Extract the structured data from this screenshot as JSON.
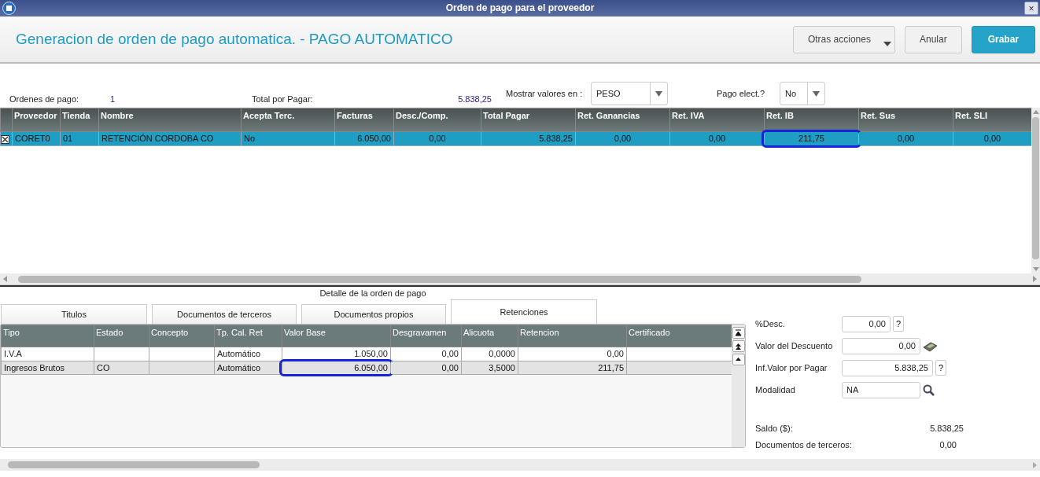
{
  "window": {
    "title": "Orden de pago para el proveedor",
    "close": "×"
  },
  "header": {
    "title": "Generacion de orden de pago automatica. - PAGO AUTOMATICO",
    "buttons": [
      {
        "label": "Otras acciones",
        "kind": "dropdown"
      },
      {
        "label": "Anular",
        "kind": "default"
      },
      {
        "label": "Grabar",
        "kind": "primary"
      }
    ]
  },
  "summary": [
    {
      "kind": "value",
      "label": "Ordenes de pago:",
      "value": "1"
    },
    {
      "kind": "value",
      "label": "Total por Pagar:",
      "value": "5.838,25"
    },
    {
      "kind": "select",
      "label": "Mostrar valores en :",
      "value": "PESO"
    },
    {
      "kind": "select",
      "label": "Pago elect.?",
      "value": "No"
    }
  ],
  "orders_table": {
    "columns": [
      "Proveedor",
      "Tienda",
      "Nombre",
      "Acepta Terc.",
      "Facturas",
      "Desc./Comp.",
      "Total Pagar",
      "Ret. Ganancias",
      "Ret. IVA",
      "Ret. IB",
      "Ret. Sus",
      "Ret. SLI"
    ],
    "rows": [
      {
        "checked": true,
        "selected": true,
        "cells": [
          {
            "text": "CORET0",
            "highlighted": false
          },
          {
            "text": "01",
            "highlighted": false
          },
          {
            "text": "RETENCIÓN CORDOBA CO",
            "highlighted": false
          },
          {
            "text": "No",
            "highlighted": false
          },
          {
            "text": "6.050,00",
            "highlighted": false
          },
          {
            "text": "0,00",
            "highlighted": false
          },
          {
            "text": "5.838,25",
            "highlighted": false
          },
          {
            "text": "0,00",
            "highlighted": false
          },
          {
            "text": "0,00",
            "highlighted": false
          },
          {
            "text": "211,75",
            "highlighted": true
          },
          {
            "text": "0,00",
            "highlighted": false
          },
          {
            "text": "0,00",
            "highlighted": false
          }
        ]
      }
    ]
  },
  "detail": {
    "caption": "Detalle de la orden de pago",
    "tabs": [
      {
        "label": "Titulos",
        "selected": false
      },
      {
        "label": "Documentos de terceros",
        "selected": false
      },
      {
        "label": "Documentos propios",
        "selected": false
      },
      {
        "label": "Retenciones",
        "selected": true
      }
    ],
    "table": {
      "columns": [
        "Tipo",
        "Estado",
        "Concepto",
        "Tp. Cal. Ret",
        "Valor Base",
        "Desgravamen",
        "Alicuota",
        "Retencion",
        "Certificado"
      ],
      "rows": [
        {
          "selected": false,
          "cells": [
            {
              "text": "I.V.A",
              "highlighted": false
            },
            {
              "highlighted": false
            },
            {
              "highlighted": false
            },
            {
              "text": "Automático",
              "highlighted": false
            },
            {
              "text": "1.050,00",
              "highlighted": false
            },
            {
              "text": "0,00",
              "highlighted": false
            },
            {
              "text": "0,0000",
              "highlighted": false
            },
            {
              "text": "0,00",
              "highlighted": false
            },
            {
              "highlighted": false
            }
          ]
        },
        {
          "selected": true,
          "cells": [
            {
              "text": "Ingresos Brutos",
              "highlighted": false
            },
            {
              "text": "CO",
              "highlighted": false
            },
            {
              "highlighted": false
            },
            {
              "text": "Automático",
              "highlighted": false
            },
            {
              "text": "6.050,00",
              "highlighted": true
            },
            {
              "text": "0,00",
              "highlighted": false
            },
            {
              "text": "3,5000",
              "highlighted": false
            },
            {
              "text": "211,75",
              "highlighted": false
            },
            {
              "highlighted": false
            }
          ]
        }
      ]
    },
    "fields": [
      {
        "label": "%Desc.",
        "value": "0,00",
        "kind": "help",
        "help": "?"
      },
      {
        "label": "Valor del Descuento",
        "value": "0,00",
        "kind": "calc"
      },
      {
        "label": "Inf.Valor por Pagar",
        "value": "5.838,25",
        "kind": "help",
        "help": "?"
      },
      {
        "label": "Modalidad",
        "value": "NA",
        "kind": "lookup"
      }
    ],
    "totals": [
      {
        "label": "Saldo ($):",
        "value": "5.838,25"
      },
      {
        "label": "Documentos de terceros:",
        "value": "0,00"
      }
    ]
  }
}
